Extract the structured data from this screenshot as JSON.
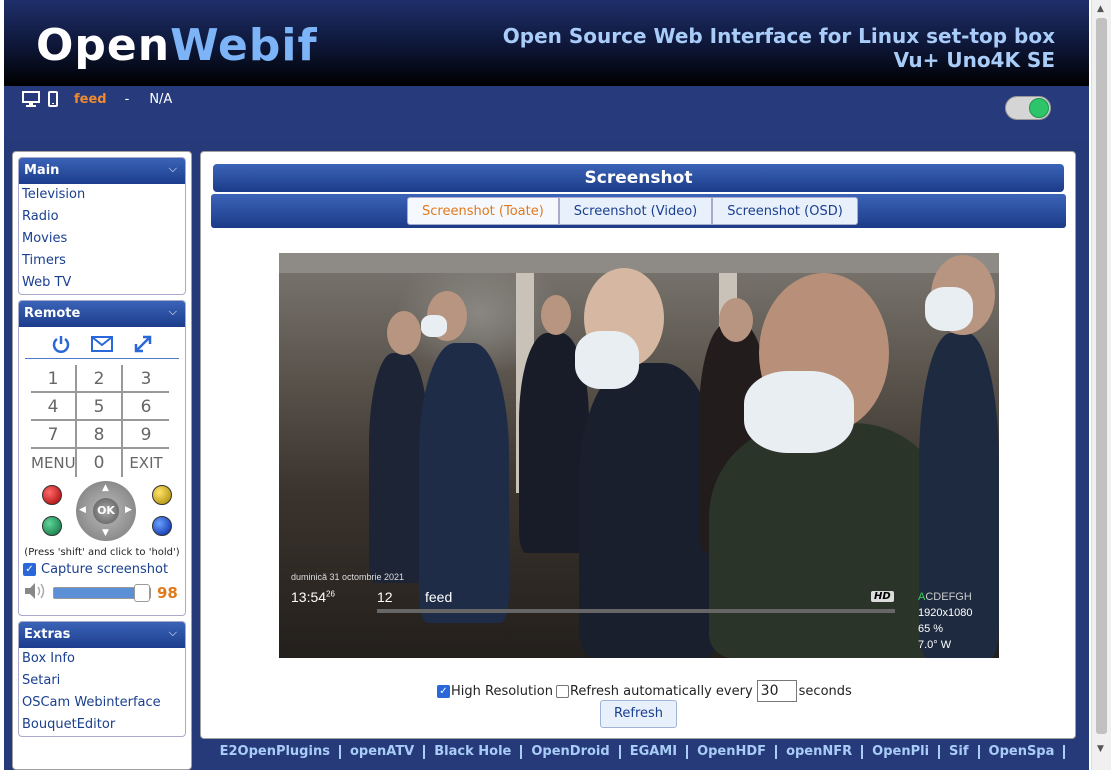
{
  "header": {
    "logo_part1": "Open",
    "logo_part2": "Webif",
    "tagline_line1": "Open Source Web Interface for Linux set-top box",
    "tagline_line2": "Vu+ Uno4K SE"
  },
  "status": {
    "channel": "feed",
    "separator": "-",
    "program": "N/A",
    "toggle_state": "on"
  },
  "sidebar": {
    "main": {
      "title": "Main",
      "items": [
        "Television",
        "Radio",
        "Movies",
        "Timers",
        "Web TV"
      ]
    },
    "remote": {
      "title": "Remote",
      "keys": [
        "1",
        "2",
        "3",
        "4",
        "5",
        "6",
        "7",
        "8",
        "9",
        "MENU",
        "0",
        "EXIT"
      ],
      "ok_label": "OK",
      "hint": "(Press 'shift' and click to 'hold')",
      "capture_label": "Capture screenshot",
      "capture_checked": true,
      "volume_value": "98",
      "volume_fraction": 0.98
    },
    "extras": {
      "title": "Extras",
      "items": [
        "Box Info",
        "Setari",
        "OSCam Webinterface",
        "BouquetEditor"
      ]
    }
  },
  "main": {
    "title": "Screenshot",
    "tabs": [
      "Screenshot (Toate)",
      "Screenshot (Video)",
      "Screenshot (OSD)"
    ],
    "active_tab": "Screenshot (Toate)",
    "osd": {
      "date": "duminică 31 octombrie 2021",
      "time": "13:54",
      "seconds": "26",
      "channel_number": "12",
      "channel_name": "feed",
      "hd_badge": "HD",
      "tuner_active": "A",
      "tuners_rest": "CDEFGH",
      "resolution": "1920x1080",
      "signal": "65 %",
      "satellite": "7.0° W"
    },
    "controls": {
      "high_res_label": "High Resolution",
      "high_res_checked": true,
      "auto_refresh_label": "Refresh automatically every",
      "auto_refresh_checked": false,
      "interval_value": "30",
      "seconds_label": "seconds",
      "refresh_button": "Refresh"
    }
  },
  "footer": {
    "links": [
      "E2OpenPlugins",
      "openATV",
      "Black Hole",
      "OpenDroid",
      "EGAMI",
      "OpenHDF",
      "openNFR",
      "OpenPli",
      "Sif",
      "OpenSpa"
    ]
  },
  "colors": {
    "accent_orange": "#e07a1d",
    "link_blue": "#1a3f8f",
    "header_gradient_top": "#3b64b8",
    "toggle_green": "#2ec46a"
  }
}
